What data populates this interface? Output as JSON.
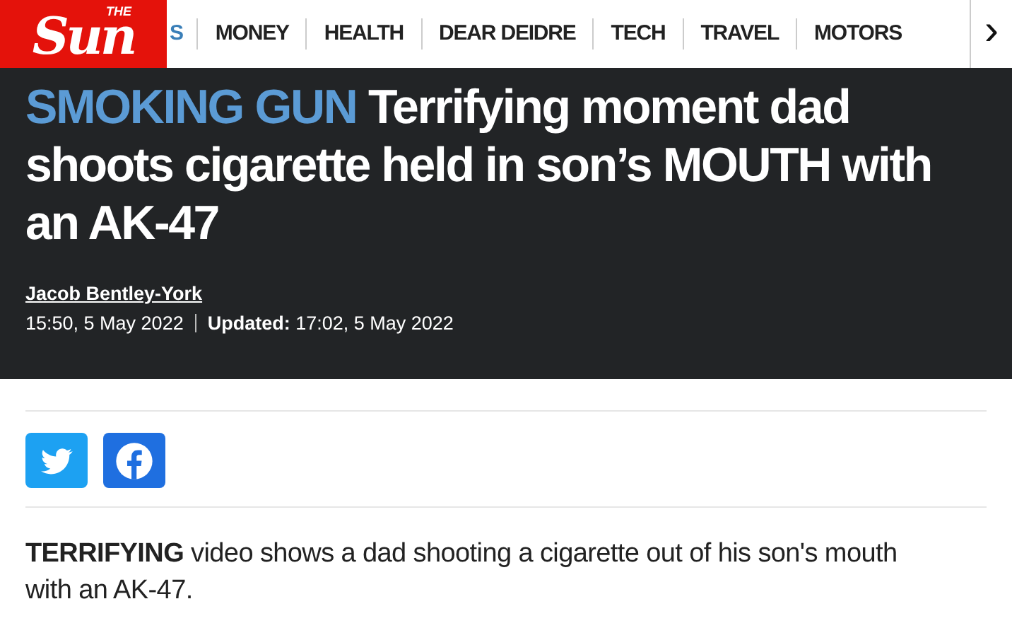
{
  "logo": {
    "top": "THE",
    "main": "Sun"
  },
  "nav": [
    {
      "label": "S",
      "selected": true
    },
    {
      "label": "MONEY",
      "selected": false
    },
    {
      "label": "HEALTH",
      "selected": false
    },
    {
      "label": "DEAR DEIDRE",
      "selected": false
    },
    {
      "label": "TECH",
      "selected": false
    },
    {
      "label": "TRAVEL",
      "selected": false
    },
    {
      "label": "MOTORS",
      "selected": false
    }
  ],
  "nav_next": "›",
  "article": {
    "kicker": "SMOKING GUN",
    "headline": "Terrifying moment dad shoots cigarette held in son’s MOUTH with an AK-47",
    "author": "Jacob Bentley-York",
    "published": "15:50, 5 May 2022",
    "updated": "**Updated:** 17:02, 5 May 2022",
    "share": [
      {
        "kind": "twitter"
      },
      {
        "kind": "facebook"
      }
    ],
    "lead": "**TERRIFYING** video shows a dad shooting a cigarette out of his son's mouth with an AK-47."
  }
}
